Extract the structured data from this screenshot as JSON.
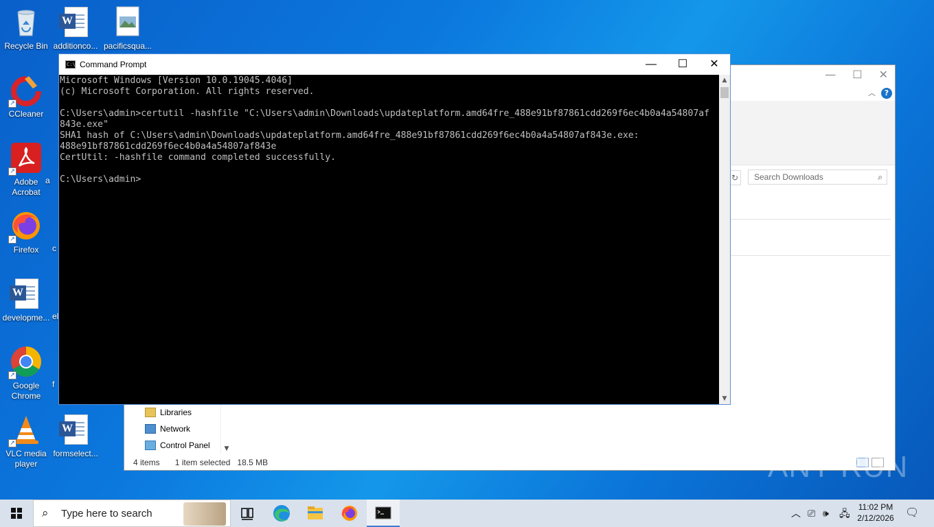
{
  "desktop": {
    "icons": [
      {
        "label": "Recycle Bin"
      },
      {
        "label": "additionco..."
      },
      {
        "label": "pacificsqua..."
      },
      {
        "label": "CCleaner"
      },
      {
        "label": "Adobe Acrobat"
      },
      {
        "label": "Firefox"
      },
      {
        "label": "developme..."
      },
      {
        "label": "Google Chrome"
      },
      {
        "label": "VLC media player"
      },
      {
        "label": "formselect..."
      }
    ],
    "partial_labels": [
      "a",
      "c",
      "el",
      "f"
    ]
  },
  "explorer": {
    "search_placeholder": "Search Downloads",
    "nav_items": [
      {
        "label": "Libraries",
        "icon": "libraries-icon"
      },
      {
        "label": "Network",
        "icon": "network-icon"
      },
      {
        "label": "Control Panel",
        "icon": "control-panel-icon"
      }
    ],
    "status": {
      "items_count": "4 items",
      "selected": "1 item selected",
      "size": "18.5 MB"
    }
  },
  "cmd": {
    "title": "Command Prompt",
    "lines": [
      "Microsoft Windows [Version 10.0.19045.4046]",
      "(c) Microsoft Corporation. All rights reserved.",
      "",
      "C:\\Users\\admin>certutil -hashfile \"C:\\Users\\admin\\Downloads\\updateplatform.amd64fre_488e91bf87861cdd269f6ec4b0a4a54807af",
      "843e.exe\"",
      "SHA1 hash of C:\\Users\\admin\\Downloads\\updateplatform.amd64fre_488e91bf87861cdd269f6ec4b0a4a54807af843e.exe:",
      "488e91bf87861cdd269f6ec4b0a4a54807af843e",
      "CertUtil: -hashfile command completed successfully.",
      "",
      "C:\\Users\\admin>"
    ]
  },
  "taskbar": {
    "search_placeholder": "Type here to search",
    "apps": [
      "task-view-icon",
      "edge-icon",
      "file-explorer-icon",
      "firefox-icon",
      "command-prompt-icon"
    ],
    "clock_time": "11:02 PM",
    "clock_date": "2/12/2026"
  },
  "watermark": "ANY RUN",
  "colors": {
    "console_bg": "#000000",
    "console_text": "#c0c0c0",
    "desktop_blue": "#0b78de",
    "taskbar": "#d8e1ec"
  }
}
